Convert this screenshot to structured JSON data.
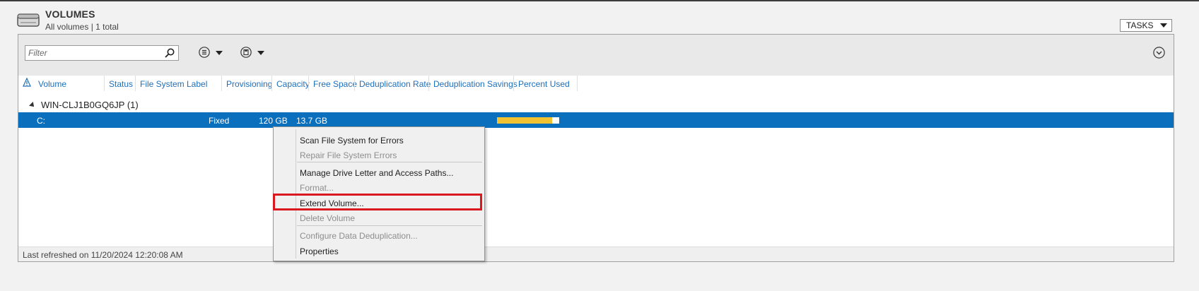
{
  "header": {
    "title": "VOLUMES",
    "subtitle": "All volumes | 1 total",
    "tasks_label": "TASKS"
  },
  "toolbar": {
    "filter_placeholder": "Filter"
  },
  "columns": [
    "Volume",
    "Status",
    "File System Label",
    "Provisioning",
    "Capacity",
    "Free Space",
    "Deduplication Rate",
    "Deduplication Savings",
    "Percent Used"
  ],
  "group": {
    "label": "WIN-CLJ1B0GQ6JP (1)"
  },
  "rows": [
    {
      "volume": "C:",
      "status": "",
      "file_system_label": "",
      "provisioning": "Fixed",
      "capacity": "120 GB",
      "free_space": "13.7 GB",
      "dedup_rate": "",
      "dedup_savings": "",
      "percent_used": 0.886
    }
  ],
  "footer": {
    "last_refreshed": "Last refreshed on 11/20/2024 12:20:08 AM"
  },
  "context_menu": {
    "items": [
      {
        "label": "Scan File System for Errors",
        "enabled": true
      },
      {
        "label": "Repair File System Errors",
        "enabled": false
      },
      {
        "label": "Manage Drive Letter and Access Paths...",
        "enabled": true
      },
      {
        "label": "Format...",
        "enabled": false
      },
      {
        "label": "Extend Volume...",
        "enabled": true,
        "highlighted": true
      },
      {
        "label": "Delete Volume",
        "enabled": false
      },
      {
        "label": "Configure Data Deduplication...",
        "enabled": false
      },
      {
        "label": "Properties",
        "enabled": true
      }
    ]
  },
  "colors": {
    "selection": "#0a6fbd",
    "link": "#1e6fb8",
    "usage_bar": "#f2c230",
    "highlight_box": "#d9181f"
  },
  "icons": [
    "drive-icon",
    "search-icon",
    "list-view-icon",
    "save-view-icon",
    "expand-icon",
    "warning-icon",
    "collapse-triangle-icon"
  ]
}
